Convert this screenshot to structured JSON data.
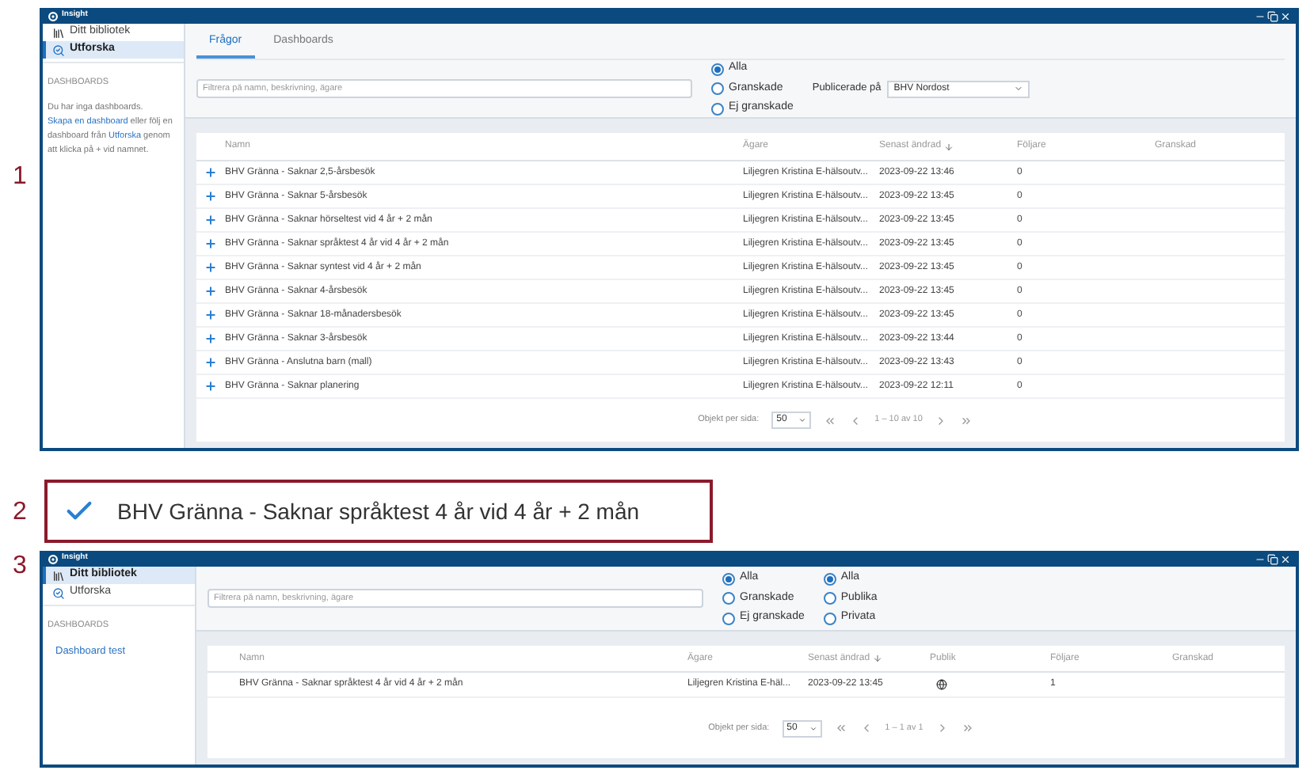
{
  "steps": [
    {
      "kind": "explore_window",
      "number": "1",
      "window": {
        "title": "Insight",
        "sidebar": {
          "items": [
            {
              "label": "Ditt bibliotek",
              "selected": false
            },
            {
              "label": "Utforska",
              "selected": true
            }
          ],
          "section_title": "DASHBOARDS",
          "message": [
            {
              "text": "Du har inga dashboards. ",
              "link": false
            },
            {
              "text": "Skapa en dashboard",
              "link": true
            },
            {
              "text": " eller följ en dashboard från ",
              "link": false
            },
            {
              "text": "Utforska",
              "link": true
            },
            {
              "text": " genom att klicka på + vid namnet.",
              "link": false
            }
          ]
        },
        "tabs": [
          {
            "label": "Frågor",
            "selected": true
          },
          {
            "label": "Dashboards",
            "selected": false
          }
        ],
        "filter": {
          "placeholder": "Filtrera på namn, beskrivning, ägare"
        },
        "radio_groups": [
          [
            {
              "label": "Alla",
              "selected": true
            },
            {
              "label": "Granskade",
              "selected": false
            },
            {
              "label": "Ej granskade",
              "selected": false
            }
          ]
        ],
        "publish_select": {
          "label": "Publicerade på",
          "value": "BHV Nordost"
        },
        "columns": [
          {
            "label": "Namn",
            "sorted": false
          },
          {
            "label": "Ägare",
            "sorted": false
          },
          {
            "label": "Senast ändrad",
            "sorted": true
          },
          {
            "label": "Följare",
            "sorted": false
          },
          {
            "label": "Granskad",
            "sorted": false
          }
        ],
        "rows": [
          {
            "cells": [
              {
                "kind": "text",
                "text": "BHV Gränna - Saknar 2,5-årsbesök"
              },
              {
                "kind": "text",
                "text": "Liljegren Kristina E-hälsoutv..."
              },
              {
                "kind": "text",
                "text": "2023-09-22 13:46"
              },
              {
                "kind": "text",
                "text": "0"
              }
            ]
          },
          {
            "cells": [
              {
                "kind": "text",
                "text": "BHV Gränna - Saknar 5-årsbesök"
              },
              {
                "kind": "text",
                "text": "Liljegren Kristina E-hälsoutv..."
              },
              {
                "kind": "text",
                "text": "2023-09-22 13:45"
              },
              {
                "kind": "text",
                "text": "0"
              }
            ]
          },
          {
            "cells": [
              {
                "kind": "text",
                "text": "BHV Gränna - Saknar hörseltest vid 4 år + 2 mån"
              },
              {
                "kind": "text",
                "text": "Liljegren Kristina E-hälsoutv..."
              },
              {
                "kind": "text",
                "text": "2023-09-22 13:45"
              },
              {
                "kind": "text",
                "text": "0"
              }
            ]
          },
          {
            "cells": [
              {
                "kind": "text",
                "text": "BHV Gränna - Saknar språktest 4 år vid 4 år + 2 mån"
              },
              {
                "kind": "text",
                "text": "Liljegren Kristina E-hälsoutv..."
              },
              {
                "kind": "text",
                "text": "2023-09-22 13:45"
              },
              {
                "kind": "text",
                "text": "0"
              }
            ]
          },
          {
            "cells": [
              {
                "kind": "text",
                "text": "BHV Gränna - Saknar syntest vid 4 år + 2 mån"
              },
              {
                "kind": "text",
                "text": "Liljegren Kristina E-hälsoutv..."
              },
              {
                "kind": "text",
                "text": "2023-09-22 13:45"
              },
              {
                "kind": "text",
                "text": "0"
              }
            ]
          },
          {
            "cells": [
              {
                "kind": "text",
                "text": "BHV Gränna - Saknar 4-årsbesök"
              },
              {
                "kind": "text",
                "text": "Liljegren Kristina E-hälsoutv..."
              },
              {
                "kind": "text",
                "text": "2023-09-22 13:45"
              },
              {
                "kind": "text",
                "text": "0"
              }
            ]
          },
          {
            "cells": [
              {
                "kind": "text",
                "text": "BHV Gränna - Saknar 18-månadersbesök"
              },
              {
                "kind": "text",
                "text": "Liljegren Kristina E-hälsoutv..."
              },
              {
                "kind": "text",
                "text": "2023-09-22 13:45"
              },
              {
                "kind": "text",
                "text": "0"
              }
            ]
          },
          {
            "cells": [
              {
                "kind": "text",
                "text": "BHV Gränna - Saknar 3-årsbesök"
              },
              {
                "kind": "text",
                "text": "Liljegren Kristina E-hälsoutv..."
              },
              {
                "kind": "text",
                "text": "2023-09-22 13:44"
              },
              {
                "kind": "text",
                "text": "0"
              }
            ]
          },
          {
            "cells": [
              {
                "kind": "text",
                "text": "BHV Gränna - Anslutna barn (mall)"
              },
              {
                "kind": "text",
                "text": "Liljegren Kristina E-hälsoutv..."
              },
              {
                "kind": "text",
                "text": "2023-09-22 13:43"
              },
              {
                "kind": "text",
                "text": "0"
              }
            ]
          },
          {
            "cells": [
              {
                "kind": "text",
                "text": "BHV Gränna - Saknar planering"
              },
              {
                "kind": "text",
                "text": "Liljegren Kristina E-hälsoutv..."
              },
              {
                "kind": "text",
                "text": "2023-09-22 12:11"
              },
              {
                "kind": "text",
                "text": "0"
              }
            ]
          }
        ],
        "pagination": {
          "label": "Objekt per sida:",
          "per_page": "50",
          "range": "1 – 10 av 10"
        }
      }
    },
    {
      "kind": "result",
      "number": "2",
      "text": "BHV Gränna - Saknar språktest 4 år vid 4 år + 2 mån"
    },
    {
      "kind": "library_window",
      "number": "3",
      "window": {
        "title": "Insight",
        "sidebar": {
          "items": [
            {
              "label": "Ditt bibliotek",
              "selected": true
            },
            {
              "label": "Utforska",
              "selected": false
            }
          ],
          "section_title": "DASHBOARDS",
          "links": [
            "Dashboard test"
          ]
        },
        "filter": {
          "placeholder": "Filtrera på namn, beskrivning, ägare"
        },
        "radio_groups": [
          [
            {
              "label": "Alla",
              "selected": true
            },
            {
              "label": "Granskade",
              "selected": false
            },
            {
              "label": "Ej granskade",
              "selected": false
            }
          ],
          [
            {
              "label": "Alla",
              "selected": true
            },
            {
              "label": "Publika",
              "selected": false
            },
            {
              "label": "Privata",
              "selected": false
            }
          ]
        ],
        "columns": [
          {
            "label": "Namn",
            "sorted": false
          },
          {
            "label": "Ägare",
            "sorted": false
          },
          {
            "label": "Senast ändrad",
            "sorted": true
          },
          {
            "label": "Publik",
            "sorted": false
          },
          {
            "label": "Följare",
            "sorted": false
          },
          {
            "label": "Granskad",
            "sorted": false
          }
        ],
        "rows": [
          {
            "cells": [
              {
                "kind": "text",
                "text": "BHV Gränna - Saknar språktest 4 år vid 4 år + 2 mån"
              },
              {
                "kind": "text",
                "text": "Liljegren Kristina E-häl..."
              },
              {
                "kind": "text",
                "text": "2023-09-22 13:45"
              },
              {
                "kind": "public",
                "on": true
              },
              {
                "kind": "text",
                "text": "1"
              }
            ]
          }
        ],
        "pagination": {
          "label": "Objekt per sida:",
          "per_page": "50",
          "range": "1 – 1 av 1"
        }
      }
    }
  ]
}
